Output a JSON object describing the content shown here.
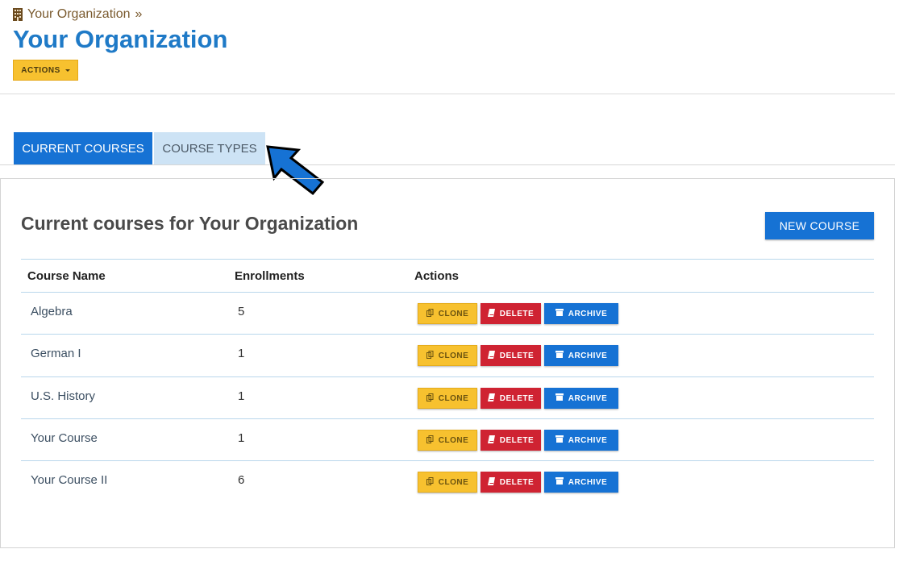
{
  "breadcrumb": {
    "org": "Your Organization",
    "separator": "»"
  },
  "page_title": "Your Organization",
  "actions_label": "ACTIONS",
  "tabs": [
    {
      "label": "CURRENT COURSES",
      "active": true
    },
    {
      "label": "COURSE TYPES",
      "active": false
    }
  ],
  "panel": {
    "title": "Current courses for Your Organization",
    "new_course_label": "NEW COURSE"
  },
  "table": {
    "headers": [
      "Course Name",
      "Enrollments",
      "Actions"
    ],
    "rows": [
      {
        "name": "Algebra",
        "enrollments": "5"
      },
      {
        "name": "German I",
        "enrollments": "1"
      },
      {
        "name": "U.S. History",
        "enrollments": "1"
      },
      {
        "name": "Your Course",
        "enrollments": "1"
      },
      {
        "name": "Your Course II",
        "enrollments": "6"
      }
    ],
    "buttons": {
      "clone": "CLONE",
      "delete": "DELETE",
      "archive": "ARCHIVE"
    }
  },
  "colors": {
    "primary": "#1672d4",
    "title": "#1f7ac7",
    "warning": "#f7c12f",
    "danger": "#cf2332",
    "tab_inactive": "#cde3f5"
  },
  "icons": {
    "breadcrumb": "building-icon",
    "clone": "copy-icon",
    "delete": "book-icon",
    "archive": "archive-icon",
    "pointer": "arrow-pointer-icon"
  }
}
